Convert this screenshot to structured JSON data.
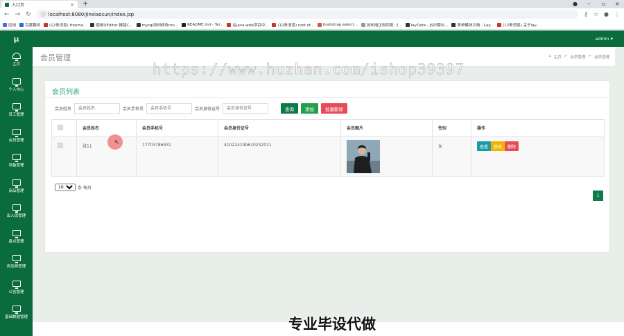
{
  "browser": {
    "tab_title": "入口页",
    "url": "localhost:8080/jinxiaocun/index.jsp",
    "bookmarks": [
      "应用",
      "百度翻译",
      "(12条消息) freema...",
      "使用UEditor 报错C...",
      "mysql如何修改roo...",
      "README.md - Ter...",
      "在java web项目中...",
      "(12条消息) root of...",
      "bootstrap-select...",
      "如何用正则匹配: 2...",
      "layDate - JS日期与...",
      "表单模块文档 - Lay...",
      "(12条消息) 关于lay..."
    ]
  },
  "app": {
    "logo": "μ",
    "user": "admin ▾",
    "sidebar": [
      {
        "label": "主页",
        "icon": "dashboard-icon"
      },
      {
        "label": "个人中心",
        "icon": "monitor-icon"
      },
      {
        "label": "员工管理",
        "icon": "monitor-icon"
      },
      {
        "label": "会员管理",
        "icon": "monitor-icon"
      },
      {
        "label": "设备管理",
        "icon": "monitor-icon"
      },
      {
        "label": "商品管理",
        "icon": "monitor-icon"
      },
      {
        "label": "出入库管理",
        "icon": "monitor-icon"
      },
      {
        "label": "盘点管理",
        "icon": "monitor-icon"
      },
      {
        "label": "供应商管理",
        "icon": "monitor-icon"
      },
      {
        "label": "公告管理",
        "icon": "monitor-icon"
      },
      {
        "label": "基础数据管理",
        "icon": "monitor-icon"
      }
    ]
  },
  "page": {
    "title": "会员管理",
    "breadcrumb": [
      "主页",
      ">",
      "会员管理",
      ">",
      "会员管理"
    ],
    "card_title": "会员列表",
    "search": {
      "name_label": "会员姓名",
      "name_placeholder": "会员姓名",
      "phone_label": "会员手机号",
      "phone_placeholder": "会员手机号",
      "id_label": "会员身份证号",
      "id_placeholder": "会员身份证号"
    },
    "buttons": {
      "query": "查询",
      "add": "添加",
      "batch_delete": "批量删除"
    },
    "table": {
      "columns": [
        "会员姓名",
        "会员手机号",
        "会员身份证号",
        "会员图片",
        "性别",
        "操作"
      ],
      "rows": [
        {
          "name": "张11",
          "phone": "17703786931",
          "id_card": "410224199610232011",
          "gender": "女",
          "actions": [
            "查看",
            "修改",
            "删除"
          ]
        }
      ]
    },
    "pager": {
      "page_size": "10",
      "per_page_label": "条 每页",
      "current_page": "1"
    }
  },
  "overlay": {
    "watermark": "https://www.huzhan.com/ishop39397",
    "caption": "专业毕设代做"
  },
  "colors": {
    "primary": "#0a6b3d",
    "accent": "#3aa57a",
    "danger": "#e84a57",
    "warning": "#f0b400",
    "info": "#1b9aaa"
  }
}
